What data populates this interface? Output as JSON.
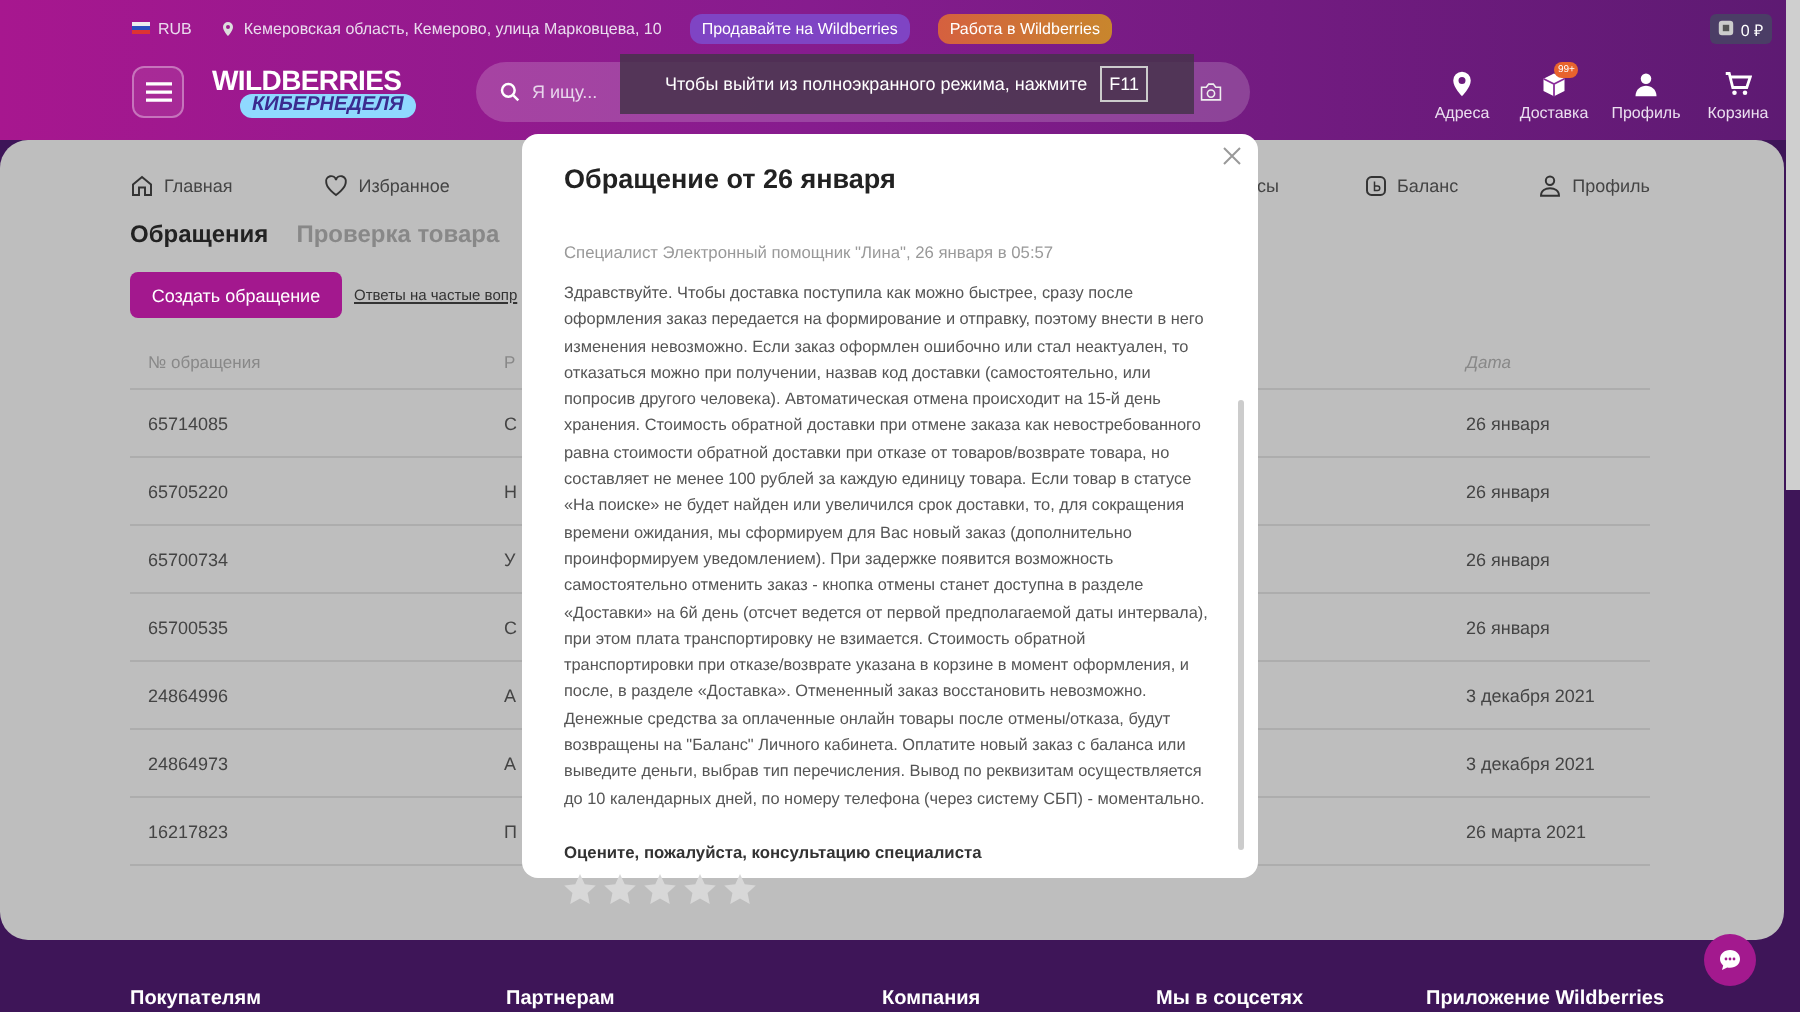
{
  "top_bar": {
    "currency": "RUB",
    "address": "Кемеровская область, Кемерово, улица Марковцева, 10",
    "links": [
      {
        "label": "Продавайте на Wildberries",
        "kind": "sell"
      },
      {
        "label": "Работа в Wildberries",
        "kind": "job"
      }
    ],
    "balance": "0 ₽"
  },
  "header": {
    "logo": "WILDBERRIES",
    "logo_subtitle": "КИБЕРНЕДЕЛЯ",
    "search": {
      "placeholder": "Я ищу..."
    },
    "actions": [
      {
        "label": "Адреса"
      },
      {
        "label": "Доставка",
        "badge": "99+"
      },
      {
        "label": "Профиль"
      },
      {
        "label": "Корзина"
      }
    ]
  },
  "fullscreen_notice": {
    "text": "Чтобы выйти из полноэкранного режима, нажмите",
    "key": "F11"
  },
  "nav": [
    {
      "label": "Главная"
    },
    {
      "label": "Избранное"
    },
    {
      "label": "сы"
    },
    {
      "label": "Баланс"
    },
    {
      "label": "Профиль"
    }
  ],
  "tabs": [
    {
      "label": "Обращения",
      "selected": true
    },
    {
      "label": "Проверка товара",
      "selected": false
    }
  ],
  "create_button": "Создать обращение",
  "faq_link": "Ответы на частые вопр",
  "table": {
    "columns": [
      "№ обращения",
      "Р",
      "Дата"
    ],
    "rows": [
      [
        "65714085",
        "С",
        "26 января"
      ],
      [
        "65705220",
        "Н",
        "26 января"
      ],
      [
        "65700734",
        "У",
        "26 января"
      ],
      [
        "65700535",
        "С",
        "26 января"
      ],
      [
        "24864996",
        "А",
        "3 декабря 2021"
      ],
      [
        "24864973",
        "А",
        "3 декабря 2021"
      ],
      [
        "16217823",
        "П",
        "26 марта 2021"
      ]
    ]
  },
  "modal": {
    "title": "Обращение от 26 января",
    "meta": "Специалист Электронный помощник \"Лина\", 26 января в 05:57",
    "body": "Здравствуйте. Чтобы доставка поступила как можно быстрее, сразу после оформления заказ передается на формирование и отправку, поэтому внести в него изменения невозможно. Если заказ оформлен ошибочно или стал неактуален, то отказаться можно при получении, назвав код доставки (самостоятельно, или попросив другого человека). Автоматическая отмена происходит на 15-й день хранения. Стоимость обратной доставки при отмене заказа как невостребованного равна стоимости обратной доставки при отказе от товаров/возврате товара, но составляет не менее 100 рублей за каждую единицу товара. Если товар в статусе «На поиске» не будет найден или увеличился срок доставки, то, для сокращения времени ожидания, мы сформируем для Вас новый заказ (дополнительно проинформируем уведомлением). При задержке появится возможность самостоятельно отменить заказ - кнопка отмены станет доступна в разделе «Доставки» на 6й день (отсчет ведется от первой предполагаемой даты интервала), при этом плата транспортировку не взимается. Стоимость обратной транспортировки при отказе/возврате указана в корзине в момент оформления, и после, в разделе «Доставка». Отмененный заказ восстановить невозможно. Денежные средства за оплаченные онлайн товары после отмены/отказа, будут возвращены на \"Баланс\" Личного кабинета. Оплатите новый заказ с баланса или выведите деньги, выбрав тип перечисления. Вывод по реквизитам осуществляется до 10 календарных дней, по номеру телефона (через систему СБП) - моментально.",
    "rating_label": "Оцените, пожалуйста, консультацию специалиста",
    "stars": 0
  },
  "footer": {
    "columns": [
      "Покупателям",
      "Партнерам",
      "Компания",
      "Мы в соцсетях",
      "Приложение Wildberries"
    ]
  }
}
